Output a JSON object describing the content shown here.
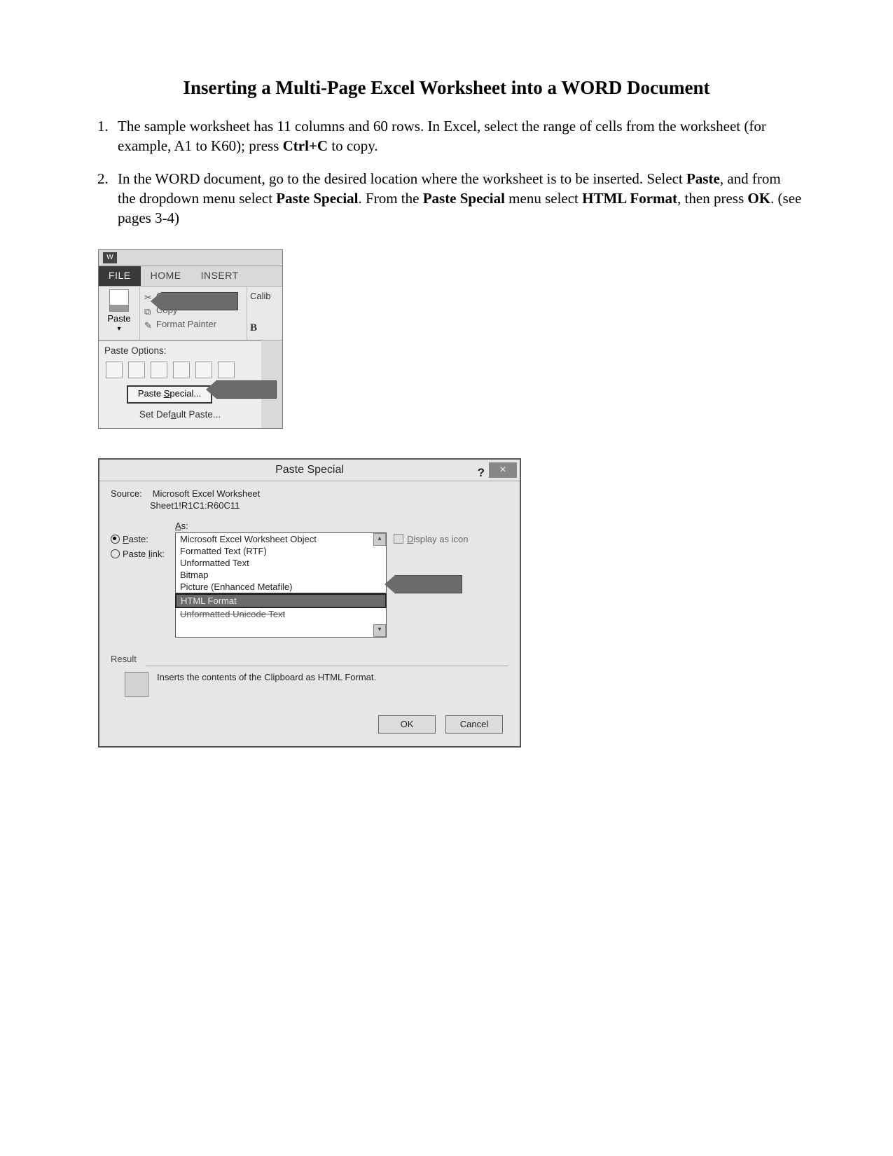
{
  "title": "Inserting a Multi-Page Excel Worksheet into a WORD Document",
  "steps": {
    "s1a": "The sample worksheet has 11 columns and 60 rows. In Excel, select the range of cells from the worksheet (for example, A1 to K60); press ",
    "s1b": "Ctrl+C",
    "s1c": " to copy.",
    "s2a": "In the WORD document, go to the desired location where the worksheet is to be inserted. Select ",
    "s2b": "Paste",
    "s2c": ", and from the dropdown menu select ",
    "s2d": "Paste Special",
    "s2e": ". From the ",
    "s2f": "Paste Special",
    "s2g": " menu select ",
    "s2h": "HTML Format",
    "s2i": ", then press ",
    "s2j": "OK",
    "s2k": ". (see pages 3-4)"
  },
  "ribbon": {
    "file": "FILE",
    "home": "HOME",
    "insert": "INSERT",
    "paste": "Paste",
    "cut": "Cut",
    "copy": "Copy",
    "format_painter": "Format Painter",
    "font": "Calib",
    "bold": "B",
    "paste_options": "Paste Options:",
    "paste_special_pre": "Paste ",
    "paste_special_key": "S",
    "paste_special_post": "pecial...",
    "set_default_pre": "Set Def",
    "set_default_key": "a",
    "set_default_post": "ult Paste..."
  },
  "dialog": {
    "title": "Paste Special",
    "close": "×",
    "help": "?",
    "source_label": "Source:",
    "source_value": "Microsoft Excel Worksheet",
    "source_ref": "Sheet1!R1C1:R60C11",
    "as_pre": "",
    "as_key": "A",
    "as_post": "s:",
    "paste_pre": "",
    "paste_key": "P",
    "paste_post": "aste:",
    "paste_link_pre": "Paste ",
    "paste_link_key": "l",
    "paste_link_post": "ink:",
    "opt0": "Microsoft Excel Worksheet Object",
    "opt1": "Formatted Text (RTF)",
    "opt2": "Unformatted Text",
    "opt3": "Bitmap",
    "opt4": "Picture (Enhanced Metafile)",
    "opt5": "HTML Format",
    "opt6": "Unformatted Unicode Text",
    "display_icon_pre": "",
    "display_icon_key": "D",
    "display_icon_post": "isplay as icon",
    "result_label": "Result",
    "result_text": "Inserts the contents of the Clipboard as HTML Format.",
    "ok": "OK",
    "cancel": "Cancel"
  }
}
